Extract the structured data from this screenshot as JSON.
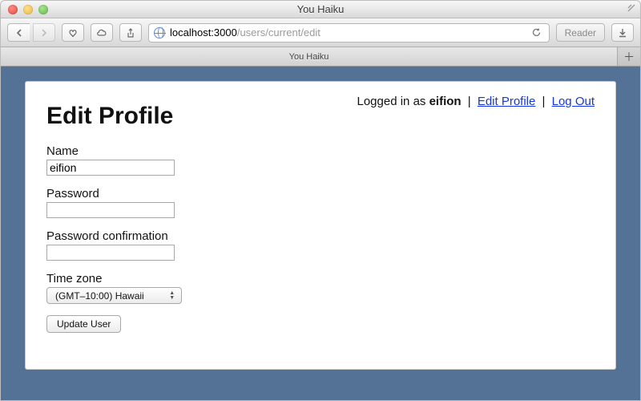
{
  "window": {
    "title": "You Haiku"
  },
  "toolbar": {
    "url_host": "localhost:3000",
    "url_path": "/users/current/edit",
    "reader_label": "Reader"
  },
  "tabs": {
    "active": "You Haiku"
  },
  "userbar": {
    "prefix": "Logged in as ",
    "username": "eifion",
    "edit_label": "Edit Profile",
    "logout_label": "Log Out"
  },
  "page": {
    "heading": "Edit Profile",
    "fields": {
      "name": {
        "label": "Name",
        "value": "eifion"
      },
      "password": {
        "label": "Password",
        "value": ""
      },
      "password_confirmation": {
        "label": "Password confirmation",
        "value": ""
      },
      "timezone": {
        "label": "Time zone",
        "selected": "(GMT–10:00) Hawaii"
      }
    },
    "submit_label": "Update User"
  }
}
